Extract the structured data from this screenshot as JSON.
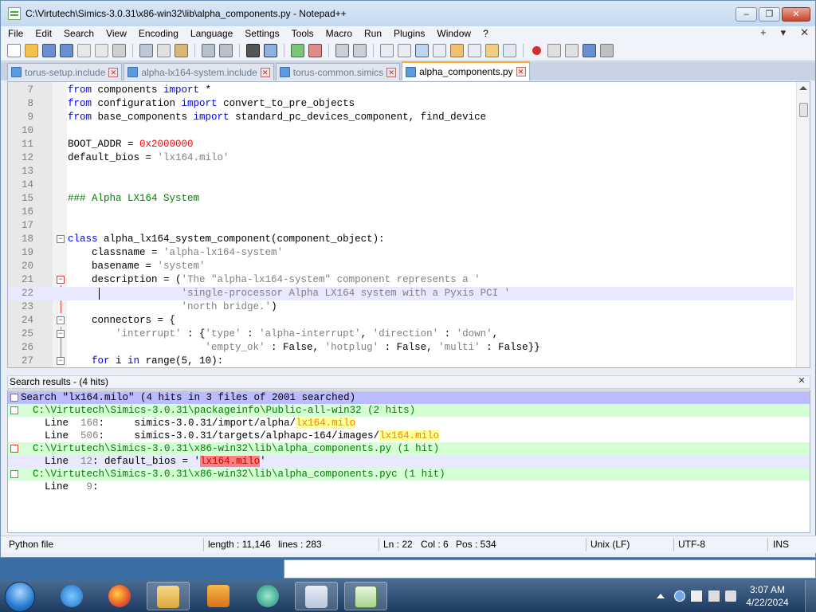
{
  "window": {
    "title": "C:\\Virtutech\\Simics-3.0.31\\x86-win32\\lib\\alpha_components.py - Notepad++",
    "controls": [
      "–",
      "❐",
      "✕"
    ]
  },
  "menu": {
    "items": [
      "File",
      "Edit",
      "Search",
      "View",
      "Encoding",
      "Language",
      "Settings",
      "Tools",
      "Macro",
      "Run",
      "Plugins",
      "Window",
      "?"
    ],
    "right": [
      "+",
      "▾",
      "✕"
    ]
  },
  "tabs": [
    {
      "label": "torus-setup.include",
      "active": false
    },
    {
      "label": "alpha-lx164-system.include",
      "active": false
    },
    {
      "label": "torus-common.simics",
      "active": false
    },
    {
      "label": "alpha_components.py",
      "active": true
    }
  ],
  "editor": {
    "current_line": 22,
    "lines": [
      {
        "n": "7",
        "segs": [
          {
            "t": "from",
            "c": "kw"
          },
          {
            "t": " components "
          },
          {
            "t": "import",
            "c": "kw"
          },
          {
            "t": " *"
          }
        ]
      },
      {
        "n": "8",
        "segs": [
          {
            "t": "from",
            "c": "kw"
          },
          {
            "t": " configuration "
          },
          {
            "t": "import",
            "c": "kw"
          },
          {
            "t": " convert_to_pre_objects"
          }
        ]
      },
      {
        "n": "9",
        "segs": [
          {
            "t": "from",
            "c": "kw"
          },
          {
            "t": " base_components "
          },
          {
            "t": "import",
            "c": "kw"
          },
          {
            "t": " standard_pc_devices_component, find_device"
          }
        ]
      },
      {
        "n": "10",
        "segs": []
      },
      {
        "n": "11",
        "segs": [
          {
            "t": "BOOT_ADDR = "
          },
          {
            "t": "0x2000000",
            "c": "num"
          }
        ]
      },
      {
        "n": "12",
        "segs": [
          {
            "t": "default_bios = "
          },
          {
            "t": "'lx164.milo'",
            "c": "str"
          }
        ]
      },
      {
        "n": "13",
        "segs": []
      },
      {
        "n": "14",
        "segs": []
      },
      {
        "n": "15",
        "segs": [
          {
            "t": "### Alpha LX164 System",
            "c": "cmt"
          }
        ]
      },
      {
        "n": "16",
        "segs": []
      },
      {
        "n": "17",
        "segs": []
      },
      {
        "n": "18",
        "segs": [
          {
            "t": "class",
            "c": "kw"
          },
          {
            "t": " alpha_lx164_system_component(component_object):"
          }
        ],
        "fold": "box"
      },
      {
        "n": "19",
        "segs": [
          {
            "t": "    classname = "
          },
          {
            "t": "'alpha-lx164-system'",
            "c": "str"
          }
        ]
      },
      {
        "n": "20",
        "segs": [
          {
            "t": "    basename = "
          },
          {
            "t": "'system'",
            "c": "str"
          }
        ]
      },
      {
        "n": "21",
        "segs": [
          {
            "t": "    description = ("
          },
          {
            "t": "'The \"alpha-lx164-system\" component represents a '",
            "c": "str"
          }
        ],
        "fold": "box-red"
      },
      {
        "n": "22",
        "segs": [
          {
            "t": "                   "
          },
          {
            "t": "'single-processor Alpha LX164 system with a Pyxis PCI '",
            "c": "str"
          }
        ]
      },
      {
        "n": "23",
        "segs": [
          {
            "t": "                   "
          },
          {
            "t": "'north bridge.'",
            "c": "str"
          },
          {
            "t": ")"
          }
        ]
      },
      {
        "n": "24",
        "segs": [
          {
            "t": "    connectors = {"
          }
        ],
        "fold": "box"
      },
      {
        "n": "25",
        "segs": [
          {
            "t": "        "
          },
          {
            "t": "'interrupt'",
            "c": "str"
          },
          {
            "t": " : {"
          },
          {
            "t": "'type'",
            "c": "str"
          },
          {
            "t": " : "
          },
          {
            "t": "'alpha-interrupt'",
            "c": "str"
          },
          {
            "t": ", "
          },
          {
            "t": "'direction'",
            "c": "str"
          },
          {
            "t": " : "
          },
          {
            "t": "'down'",
            "c": "str"
          },
          {
            "t": ","
          }
        ],
        "fold": "box"
      },
      {
        "n": "26",
        "segs": [
          {
            "t": "                       "
          },
          {
            "t": "'empty_ok'",
            "c": "str"
          },
          {
            "t": " : False, "
          },
          {
            "t": "'hotplug'",
            "c": "str"
          },
          {
            "t": " : False, "
          },
          {
            "t": "'multi'",
            "c": "str"
          },
          {
            "t": " : False}}"
          }
        ]
      },
      {
        "n": "27",
        "segs": [
          {
            "t": "    "
          },
          {
            "t": "for",
            "c": "kw"
          },
          {
            "t": " i "
          },
          {
            "t": "in",
            "c": "kw"
          },
          {
            "t": " range(5, 10):"
          }
        ],
        "fold": "box"
      }
    ]
  },
  "search_results": {
    "header": "Search results - (4 hits)",
    "close": "✕",
    "lines": [
      {
        "kind": "search",
        "segs": [
          {
            "t": "Search \"lx164.milo\" (4 hits in 3 files of 2001 searched)"
          }
        ]
      },
      {
        "kind": "file",
        "segs": [
          {
            "t": "  C:\\Virtutech\\Simics-3.0.31\\packageinfo\\Public-all-win32 (2 hits)"
          }
        ]
      },
      {
        "kind": "hit",
        "segs": [
          {
            "t": "    Line  "
          },
          {
            "t": "168",
            "c": "sr-ln"
          },
          {
            "t": ":     simics-3.0.31/import/alpha/"
          },
          {
            "t": "lx164.milo",
            "c": "hit"
          }
        ]
      },
      {
        "kind": "hit",
        "segs": [
          {
            "t": "    Line  "
          },
          {
            "t": "506",
            "c": "sr-ln"
          },
          {
            "t": ":     simics-3.0.31/targets/alphapc-164/images/"
          },
          {
            "t": "lx164.milo",
            "c": "hit"
          }
        ]
      },
      {
        "kind": "file",
        "segs": [
          {
            "t": "  C:\\Virtutech\\Simics-3.0.31\\x86-win32\\lib\\alpha_components.py (1 hit)"
          }
        ]
      },
      {
        "kind": "hit-current",
        "segs": [
          {
            "t": "    Line  "
          },
          {
            "t": "12",
            "c": "sr-ln"
          },
          {
            "t": ": default_bios = '"
          },
          {
            "t": "lx164.milo",
            "c": "hit-cur"
          },
          {
            "t": "'"
          }
        ]
      },
      {
        "kind": "file",
        "segs": [
          {
            "t": "  C:\\Virtutech\\Simics-3.0.31\\x86-win32\\lib\\alpha_components.pyc (1 hit)"
          }
        ]
      },
      {
        "kind": "hit",
        "segs": [
          {
            "t": "    Line   "
          },
          {
            "t": "9",
            "c": "sr-ln"
          },
          {
            "t": ":"
          }
        ]
      }
    ]
  },
  "status": {
    "filetype": "Python file",
    "length": "length : 11,146",
    "lines": "lines : 283",
    "ln": "Ln : 22",
    "col": "Col : 6",
    "pos": "Pos : 534",
    "eol": "Unix (LF)",
    "encoding": "UTF-8",
    "mode": "INS"
  },
  "taskbar": {
    "time": "3:07 AM",
    "date": "4/22/2024"
  },
  "colors": {
    "keyword": "#0000ff",
    "string": "#808080",
    "number": "#ff0000",
    "comment": "#008000",
    "current_line": "#e8e8ff",
    "search_header": "#bbbbff",
    "file_row": "#d5ffd5"
  }
}
